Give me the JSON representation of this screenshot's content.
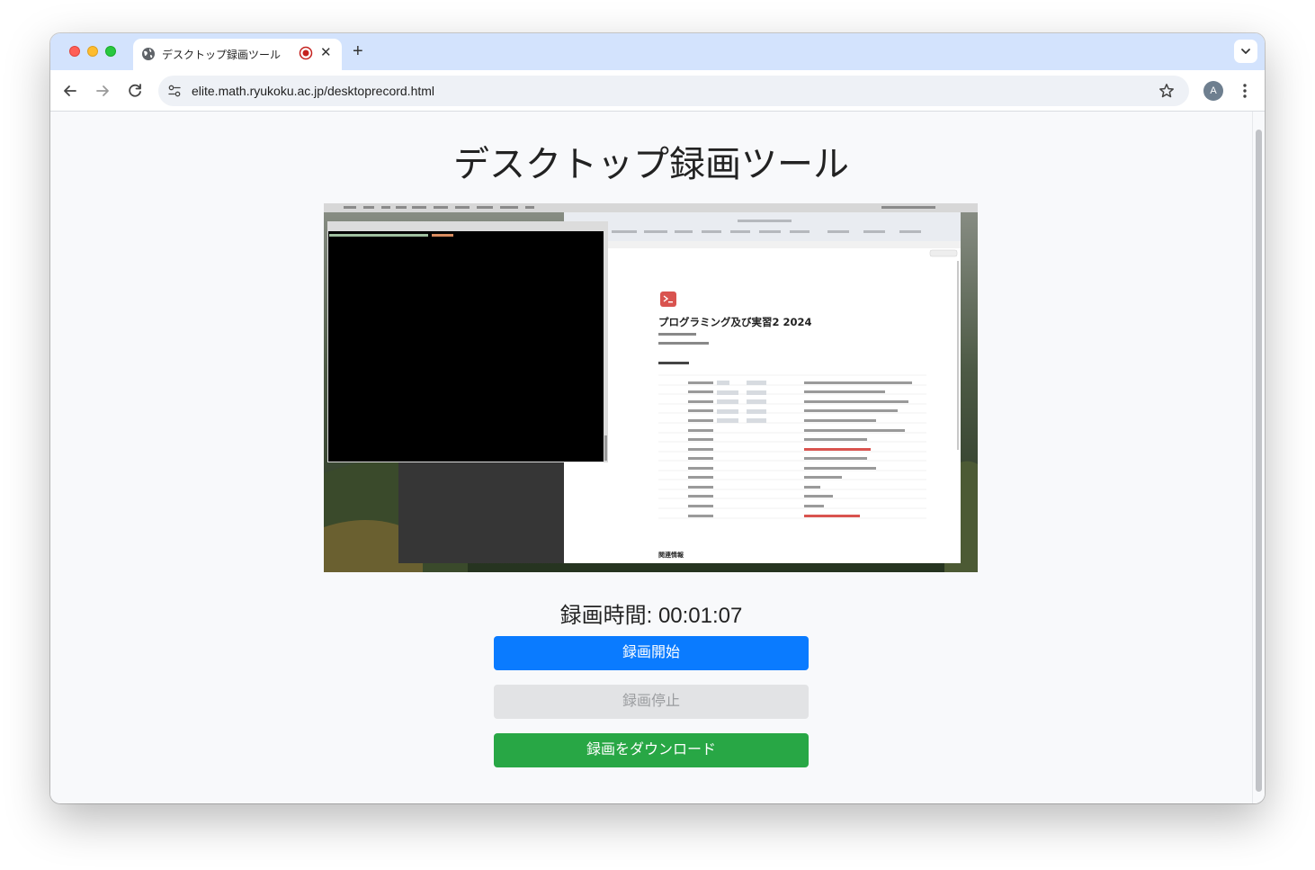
{
  "browser": {
    "tab_title": "デスクトップ録画ツール",
    "url": "elite.math.ryukoku.ac.jp/desktoprecord.html",
    "profile_initial": "A"
  },
  "page": {
    "title": "デスクトップ録画ツール",
    "timer_label": "録画時間: 00:01:07",
    "buttons": {
      "start": "録画開始",
      "stop": "録画停止",
      "download": "録画をダウンロード"
    }
  },
  "preview": {
    "notion_title": "プログラミング及び実習2 2024",
    "related_label": "関連情報"
  },
  "colors": {
    "start": "#0a7bff",
    "stop_disabled": "#e2e3e5",
    "download": "#28a745",
    "tabstrip": "#d3e3fd"
  }
}
